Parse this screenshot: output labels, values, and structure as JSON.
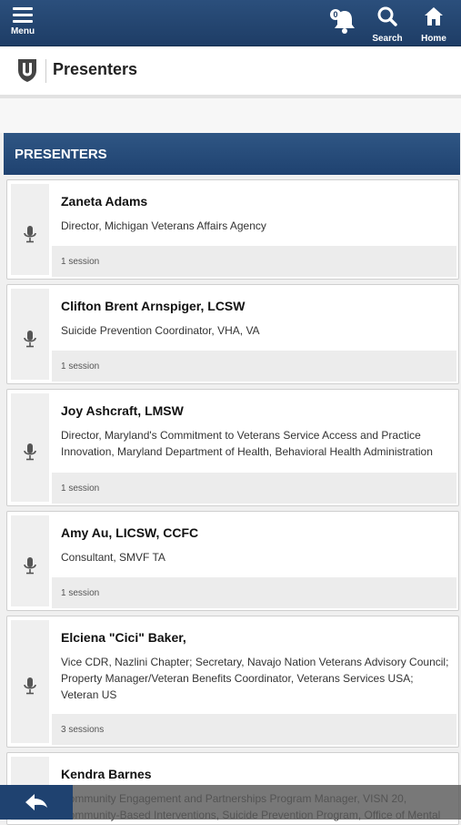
{
  "nav": {
    "menu_label": "Menu",
    "notifications_count": "0",
    "search_label": "Search",
    "home_label": "Home"
  },
  "page": {
    "title": "Presenters"
  },
  "section": {
    "header": "PRESENTERS"
  },
  "presenters": [
    {
      "name": "Zaneta Adams",
      "role": "Director, Michigan Veterans Affairs Agency",
      "sessions": "1 session"
    },
    {
      "name": "Clifton Brent Arnspiger, LCSW",
      "role": "Suicide Prevention Coordinator, VHA, VA",
      "sessions": "1 session"
    },
    {
      "name": "Joy Ashcraft, LMSW",
      "role": "Director, Maryland's Commitment to Veterans Service Access and Practice Innovation, Maryland Department of Health, Behavioral Health Administration",
      "sessions": "1 session"
    },
    {
      "name": "Amy Au, LICSW, CCFC",
      "role": "Consultant, SMVF TA",
      "sessions": "1 session"
    },
    {
      "name": "Elciena \"Cici\" Baker,",
      "role": "Vice CDR, Nazlini Chapter; Secretary, Navajo Nation Veterans Advisory Council; Property Manager/Veteran Benefits Coordinator, Veterans Services USA; Veteran US",
      "sessions": "3 sessions"
    },
    {
      "name": "Kendra Barnes",
      "role": "Community Engagement and Partnerships Program Manager, VISN 20, Community-Based Interventions, Suicide Prevention Program, Office of Mental",
      "sessions": ""
    }
  ],
  "colors": {
    "nav_bg": "#1e3d66",
    "section_bg": "#1f4270",
    "card_footer": "#ececec"
  },
  "icons": {
    "menu": "hamburger-icon",
    "notifications": "bell-icon",
    "search": "search-icon",
    "home": "home-icon",
    "presenter": "microphone-icon",
    "back": "back-arrow-icon"
  }
}
